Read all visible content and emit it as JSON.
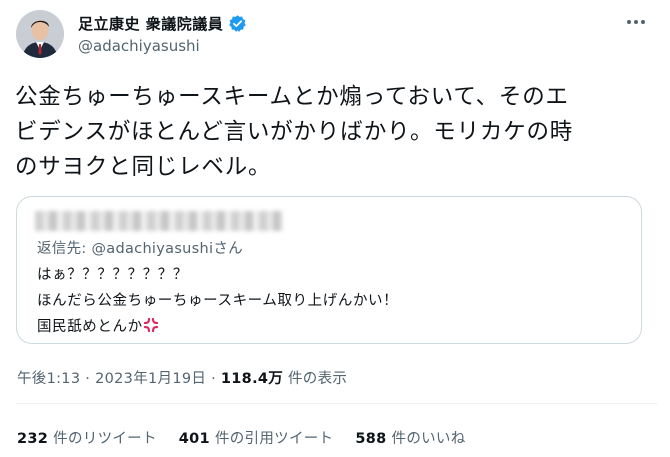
{
  "author": {
    "display_name": "足立康史 衆議院議員",
    "handle": "@adachiyasushi",
    "avatar_icon": "person-avatar",
    "verified_icon": "verified-badge-icon",
    "accent": "#1d9bf0"
  },
  "more_icon": "more-dots-icon",
  "tweet_text": [
    "公金ちゅーちゅースキームとか煽っておいて、そのエ",
    "ビデンスがほとんど言いがかりばかり。モリカケの時",
    "のサヨクと同じレベル。"
  ],
  "quoted": {
    "reply_label": "返信先: ",
    "reply_handle": "@adachiyasushi",
    "reply_suffix": "さん",
    "lines": [
      "はぁ？？？？？？？？",
      "ほんだら公金ちゅーちゅースキーム取り上げんかい！",
      "国民舐めとんか"
    ],
    "emoji_icon": "anger-symbol-icon"
  },
  "meta": {
    "time_date": "午後1:13 · 2023年1月19日 · ",
    "views_count": "118.4万",
    "views_label": " 件の表示"
  },
  "stats": {
    "retweets_count": "232",
    "retweets_label": "件のリツイート",
    "quotes_count": "401",
    "quotes_label": "件の引用ツイート",
    "likes_count": "588",
    "likes_label": "件のいいね"
  }
}
